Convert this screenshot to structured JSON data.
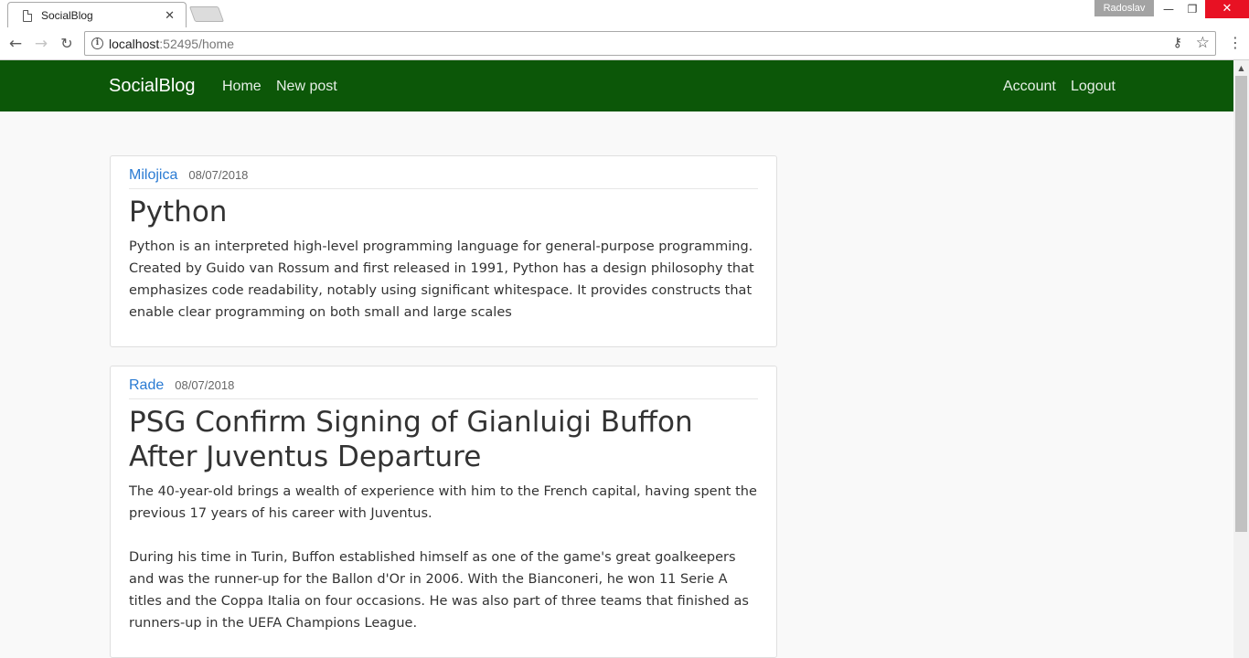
{
  "browser": {
    "tab_title": "SocialBlog",
    "tab_close": "✕",
    "profile_name": "Radoslav",
    "url_host": "localhost",
    "url_rest": ":52495/home",
    "window_controls": {
      "minimize": "—",
      "restore": "❐",
      "close": "✕"
    },
    "nav_icons": {
      "back": "←",
      "forward": "→",
      "reload": "↻",
      "info": "i",
      "key": "⚷",
      "star": "☆",
      "menu": "⋮"
    }
  },
  "navbar": {
    "brand": "SocialBlog",
    "left_links": [
      "Home",
      "New post"
    ],
    "right_links": [
      "Account",
      "Logout"
    ],
    "background_color": "#0c5708"
  },
  "posts": [
    {
      "author": "Milojica",
      "date": "08/07/2018",
      "title": "Python",
      "paragraphs": [
        "Python is an interpreted high-level programming language for general-purpose programming. Created by Guido van Rossum and first released in 1991, Python has a design philosophy that emphasizes code readability, notably using significant whitespace. It provides constructs that enable clear programming on both small and large scales"
      ]
    },
    {
      "author": "Rade",
      "date": "08/07/2018",
      "title": "PSG Confirm Signing of Gianluigi Buffon After Juventus Departure",
      "paragraphs": [
        "The 40-year-old brings a wealth of experience with him to the French capital, having spent the previous 17 years of his career with Juventus.",
        "During his time in Turin, Buffon established himself as one of the game's great goalkeepers and was the runner-up for the Ballon d'Or in 2006. With the Bianconeri, he won 11 Serie A titles and the Coppa Italia on four occasions. He was also part of three teams that finished as runners-up in the UEFA Champions League."
      ]
    }
  ],
  "colors": {
    "author_link": "#2a7bd3",
    "page_bg": "#f9f9f9"
  }
}
